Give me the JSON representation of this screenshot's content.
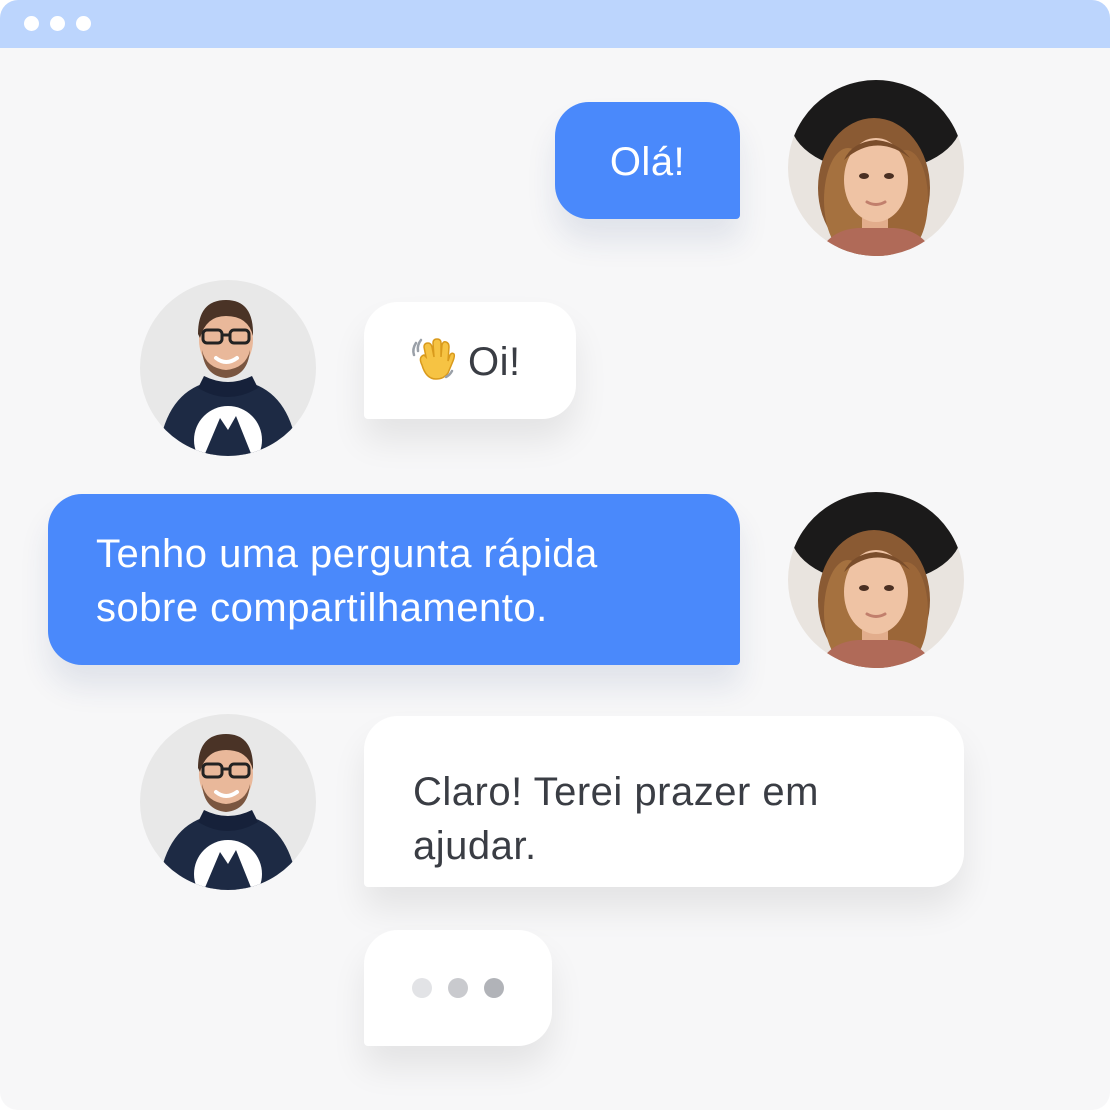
{
  "window": {
    "controls": [
      "window-dot",
      "window-dot",
      "window-dot"
    ]
  },
  "messages": [
    {
      "id": "m1",
      "direction": "outgoing",
      "text": "Olá!",
      "avatar": "woman-avatar"
    },
    {
      "id": "m2",
      "direction": "incoming",
      "emoji": "waving-hand-icon",
      "text": "Oi!",
      "avatar": "man-avatar"
    },
    {
      "id": "m3",
      "direction": "outgoing",
      "lines": [
        "Tenho uma pergunta rápida",
        "sobre compartilhamento."
      ],
      "avatar": "woman-avatar"
    },
    {
      "id": "m4",
      "direction": "incoming",
      "lines": [
        "Claro! Terei prazer em",
        "ajudar."
      ],
      "avatar": "man-avatar"
    }
  ],
  "typing_indicator": {
    "direction": "incoming",
    "dots": 3
  },
  "colors": {
    "titlebar": "#bcd5fd",
    "outgoing_bubble": "#4a89fb",
    "incoming_bubble": "#ffffff",
    "background": "#f7f7f8",
    "incoming_text": "#3a3d44"
  }
}
